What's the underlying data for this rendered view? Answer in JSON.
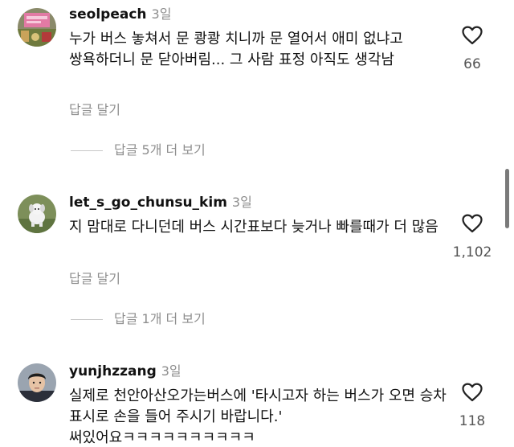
{
  "comments": [
    {
      "username": "seolpeach",
      "time": "3일",
      "text": "누가 버스 놓쳐서 문 쾅쾅 치니까 문 열어서 애미 없냐고 쌍욕하더니 문 닫아버림... 그 사람 표정 아직도 생각남",
      "reply_label": "답글 달기",
      "view_replies": "답글 5개 더 보기",
      "likes": "66",
      "avatar_icon": "profile-photo-icon"
    },
    {
      "username": "let_s_go_chunsu_kim",
      "time": "3일",
      "text": "지 맘대로 다니던데 버스 시간표보다 늦거나 빠를때가 더 많음",
      "reply_label": "답글 달기",
      "view_replies": "답글 1개 더 보기",
      "likes": "1,102",
      "avatar_icon": "toy-dog-photo-icon"
    },
    {
      "username": "yunjhzzang",
      "time": "3일",
      "text": "실제로 천안아산오가는버스에 '타시고자 하는 버스가 오면 승차 표시로 손을 들어 주시기 바랍니다.' 써있어요ㅋㅋㅋㅋㅋㅋㅋㅋㅋㅋ",
      "likes": "118",
      "avatar_icon": "person-photo-icon"
    }
  ],
  "icons": {
    "like": "heart-outline-icon"
  }
}
